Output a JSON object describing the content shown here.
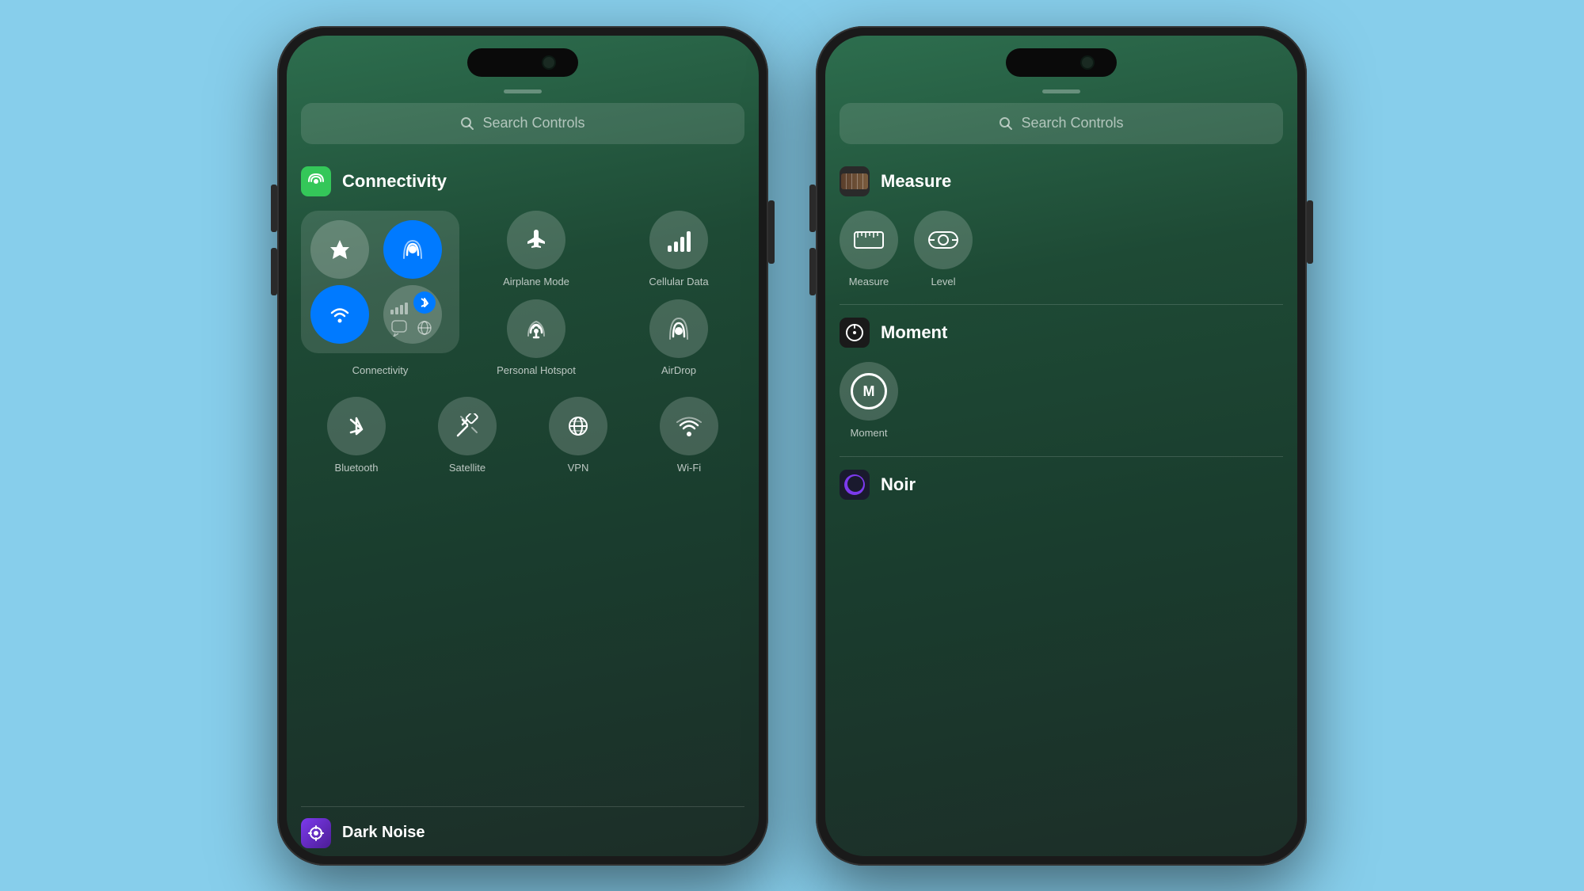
{
  "phone1": {
    "search": {
      "placeholder": "Search Controls"
    },
    "sections": {
      "connectivity": {
        "title": "Connectivity",
        "icon_color": "#34c759",
        "cluster_buttons": [
          {
            "id": "airplane",
            "active": false,
            "label": ""
          },
          {
            "id": "airdrop_cluster",
            "active": true,
            "label": ""
          },
          {
            "id": "wifi",
            "active": true,
            "label": ""
          },
          {
            "id": "cellular_small",
            "active": false,
            "label": ""
          },
          {
            "id": "bluetooth_small",
            "active": false,
            "label": ""
          },
          {
            "id": "bubble",
            "active": false,
            "label": ""
          },
          {
            "id": "globe_small",
            "active": false,
            "label": ""
          }
        ],
        "cluster_label": "Connectivity",
        "separate_controls": [
          {
            "id": "airplane_mode",
            "label": "Airplane Mode"
          },
          {
            "id": "cellular_data",
            "label": "Cellular Data"
          },
          {
            "id": "personal_hotspot",
            "label": "Personal\nHotspot"
          },
          {
            "id": "airdrop",
            "label": "AirDrop"
          }
        ]
      },
      "bottom_controls": [
        {
          "id": "bluetooth",
          "label": "Bluetooth"
        },
        {
          "id": "satellite",
          "label": "Satellite"
        },
        {
          "id": "vpn",
          "label": "VPN"
        },
        {
          "id": "wifi_bottom",
          "label": "Wi-Fi"
        }
      ]
    },
    "bottom_section": {
      "title": "Dark Noise"
    }
  },
  "phone2": {
    "search": {
      "placeholder": "Search Controls"
    },
    "sections": {
      "measure": {
        "title": "Measure",
        "controls": [
          {
            "id": "measure",
            "label": "Measure"
          },
          {
            "id": "level",
            "label": "Level"
          }
        ]
      },
      "moment": {
        "title": "Moment",
        "controls": [
          {
            "id": "moment",
            "label": "Moment"
          }
        ]
      },
      "noir": {
        "title": "Noir"
      }
    }
  }
}
